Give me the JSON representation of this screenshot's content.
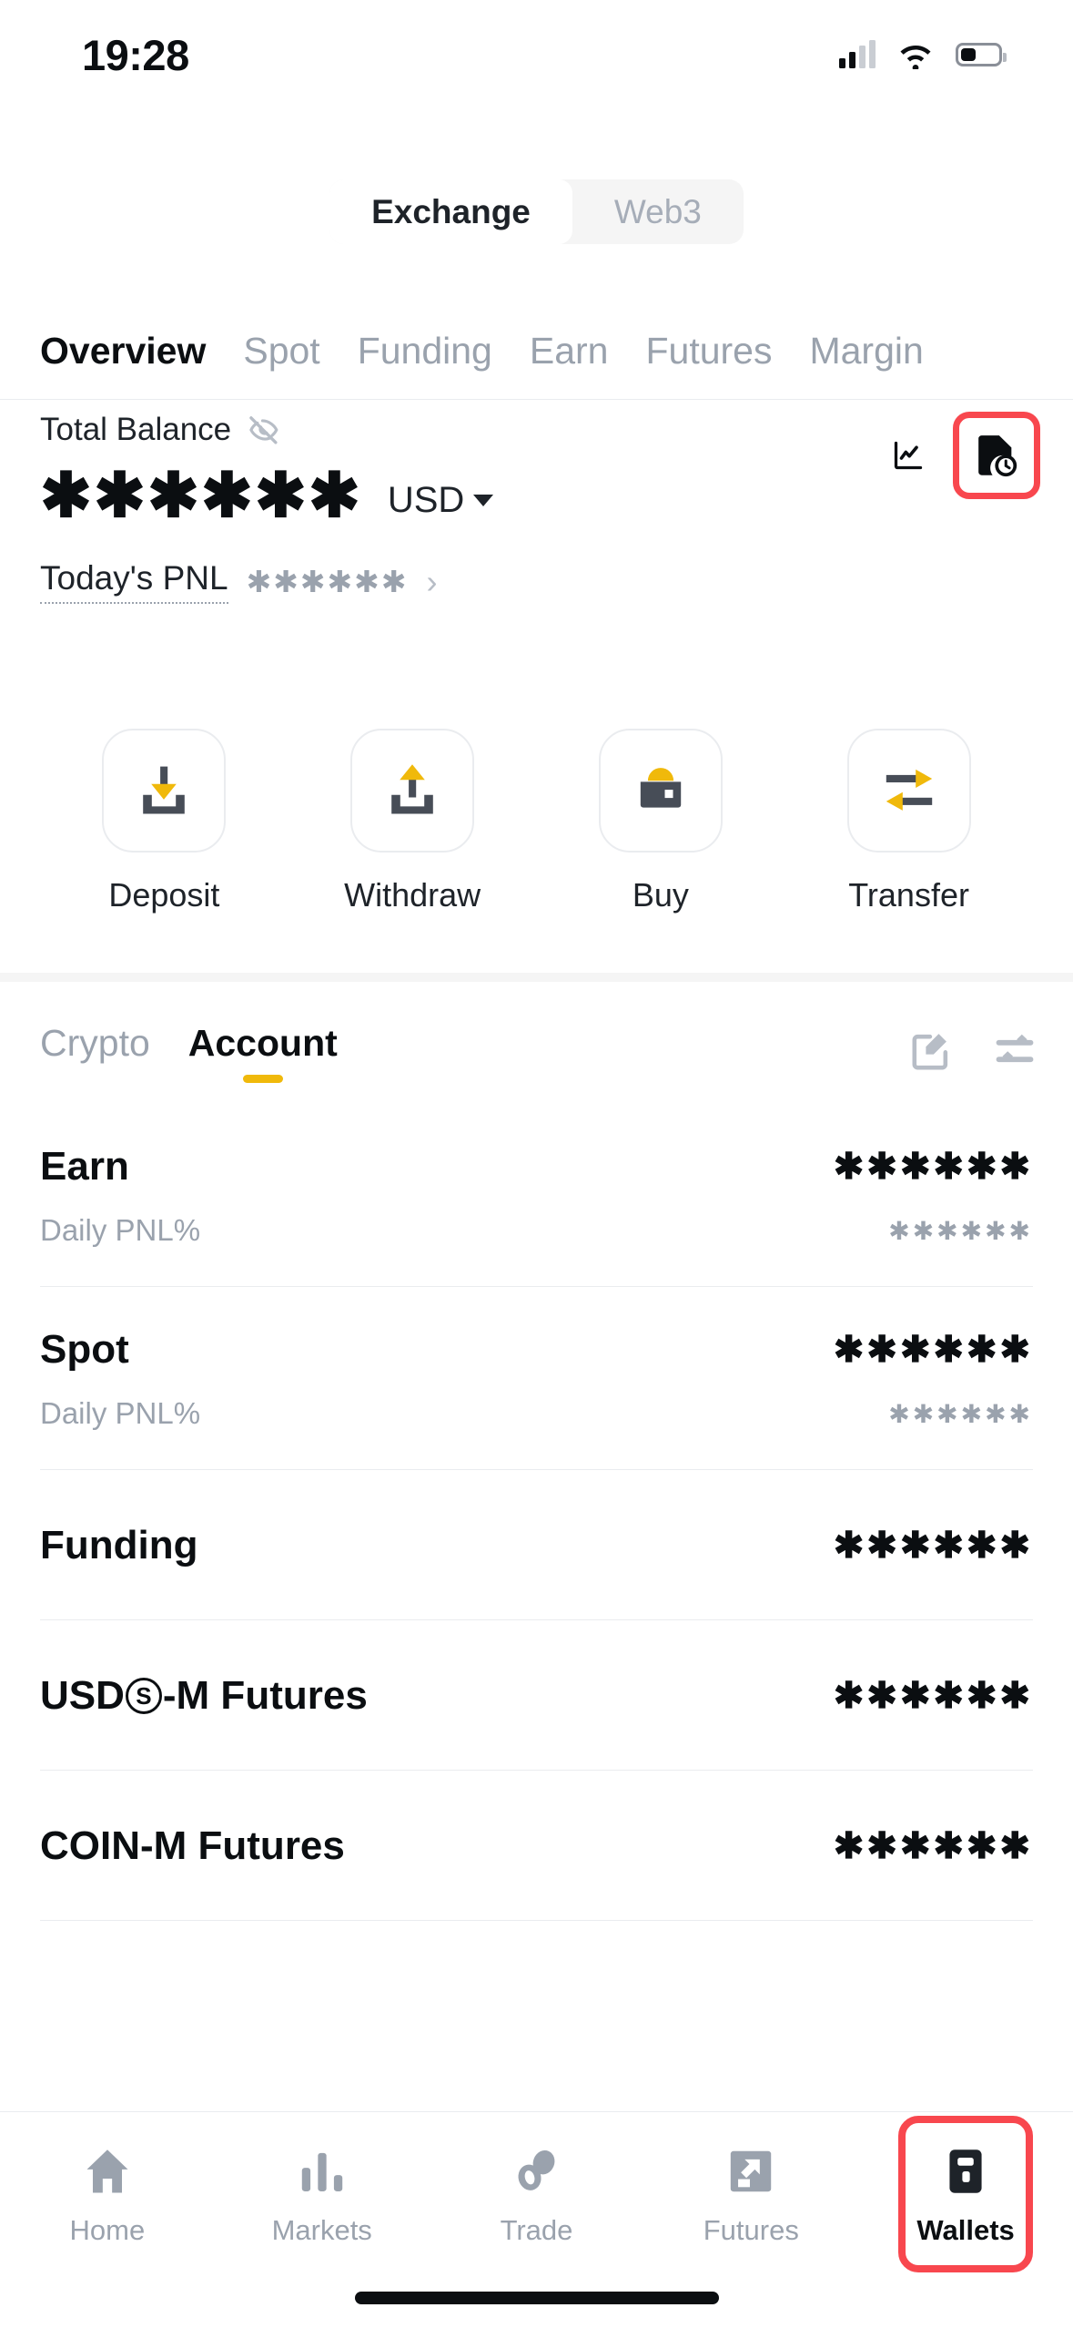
{
  "status_bar": {
    "time": "19:28",
    "signal_icon": "cellular-signal-icon",
    "wifi_icon": "wifi-icon",
    "battery_icon": "battery-icon"
  },
  "segmented_control": {
    "items": [
      {
        "label": "Exchange",
        "active": true
      },
      {
        "label": "Web3",
        "active": false
      }
    ]
  },
  "wallet_tabs": [
    {
      "label": "Overview",
      "active": true
    },
    {
      "label": "Spot",
      "active": false
    },
    {
      "label": "Funding",
      "active": false
    },
    {
      "label": "Earn",
      "active": false
    },
    {
      "label": "Futures",
      "active": false
    },
    {
      "label": "Margin",
      "active": false
    }
  ],
  "balance": {
    "label": "Total Balance",
    "visibility_icon": "eye-off-icon",
    "amount_masked": "✱✱✱✱✱✱",
    "currency": "USD",
    "currency_caret": "chevron-down-icon",
    "pnl_label": "Today's PNL",
    "pnl_value_masked": "✱✱✱✱✱✱",
    "pnl_chevron": "›",
    "chart_icon": "analytics-chart-icon",
    "history_icon": "transaction-history-icon",
    "history_highlighted": true,
    "highlight_color": "#f8474e"
  },
  "quick_actions": [
    {
      "label": "Deposit",
      "icon": "deposit-arrow-down-icon"
    },
    {
      "label": "Withdraw",
      "icon": "withdraw-arrow-up-icon"
    },
    {
      "label": "Buy",
      "icon": "buy-wallet-icon"
    },
    {
      "label": "Transfer",
      "icon": "transfer-arrows-icon"
    }
  ],
  "account_section": {
    "tabs": [
      {
        "label": "Crypto",
        "active": false
      },
      {
        "label": "Account",
        "active": true
      }
    ],
    "edit_icon": "edit-square-icon",
    "filter_icon": "filter-sliders-icon",
    "accent_color": "#f0b90b",
    "rows": [
      {
        "name": "Earn",
        "value_masked": "✱✱✱✱✱✱",
        "sub_label": "Daily PNL%",
        "sub_value_masked": "✱✱✱✱✱✱"
      },
      {
        "name": "Spot",
        "value_masked": "✱✱✱✱✱✱",
        "sub_label": "Daily PNL%",
        "sub_value_masked": "✱✱✱✱✱✱"
      },
      {
        "name": "Funding",
        "value_masked": "✱✱✱✱✱✱"
      },
      {
        "name_prefix": "USD",
        "name_symbol": "S",
        "name_suffix": "-M Futures",
        "value_masked": "✱✱✱✱✱✱"
      },
      {
        "name": "COIN-M Futures",
        "value_masked": "✱✱✱✱✱✱"
      }
    ]
  },
  "bottom_nav": {
    "items": [
      {
        "label": "Home",
        "icon": "home-icon",
        "active": false
      },
      {
        "label": "Markets",
        "icon": "markets-bars-icon",
        "active": false
      },
      {
        "label": "Trade",
        "icon": "trade-swap-icon",
        "active": false
      },
      {
        "label": "Futures",
        "icon": "futures-chart-icon",
        "active": false
      },
      {
        "label": "Wallets",
        "icon": "wallets-icon",
        "active": true
      }
    ],
    "highlight_color": "#f8474e",
    "home_indicator": "home-indicator-bar"
  }
}
